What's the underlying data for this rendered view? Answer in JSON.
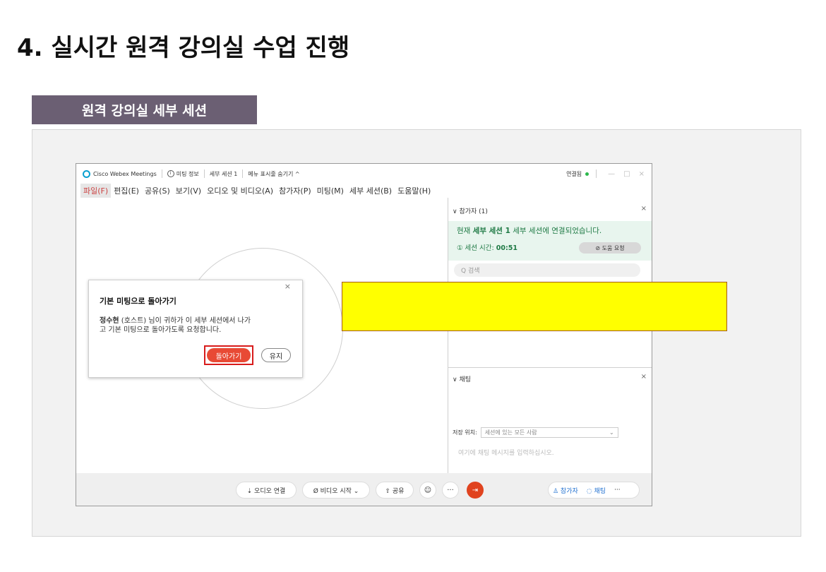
{
  "page": {
    "title": "4. 실시간 원격 강의실 수업 진행",
    "section_tab": "원격 강의실 세부 세션"
  },
  "titlebar": {
    "app_name": "Cisco Webex Meetings",
    "meeting_info": "미팅 정보",
    "session": "세부 세션 1",
    "hide_menu": "메뉴 표시줄 숨기기 ^",
    "status": "연결됨",
    "minimize": "—",
    "maximize": "□",
    "close": "×"
  },
  "menu": [
    "파일(F)",
    "편집(E)",
    "공유(S)",
    "보기(V)",
    "오디오 및 비디오(A)",
    "참가자(P)",
    "미팅(M)",
    "세부 세션(B)",
    "도움말(H)"
  ],
  "dialog": {
    "close": "×",
    "title": "기본 미팅으로 돌아가기",
    "host": "정수현",
    "message_line1": " (호스트) 님이 귀하가 이 세부 세션에서 나가",
    "message_line2": "고 기본 미팅으로 돌아가도록 요청합니다.",
    "primary": "돌아가기",
    "secondary": "유지"
  },
  "sidebar": {
    "participants_header": "∨ 참가자 (1)",
    "close": "×",
    "connected_prefix": "현재 ",
    "connected_session": "세부 세션 1",
    "connected_suffix": " 세부 세션에 연결되었습니다.",
    "session_time_label": "① 세션 시간: ",
    "session_time": "00:51",
    "help_button": "⊘ 도움 요청",
    "search_placeholder": "Q  검색",
    "chat_header": "∨ 채팅",
    "send_to_label": "저장 위치:",
    "send_to_value": "세션에 있는 모든 사람",
    "chat_placeholder": "여기에 채팅 메시지를 입력하십시오."
  },
  "controls": {
    "audio": "⇣ 오디오 연결",
    "video": "Ø 비디오 시작  ⌄",
    "share": "⇧ 공유",
    "emoji": "☺",
    "more": "···",
    "leave": "⇥",
    "participants": "♙ 참가자",
    "chat": "◌ 채팅",
    "right_more": "···"
  },
  "colors": {
    "section_tab": "#6b5f73",
    "highlight": "#ffff00",
    "leave": "#e0431f",
    "connected": "#2db84d"
  }
}
